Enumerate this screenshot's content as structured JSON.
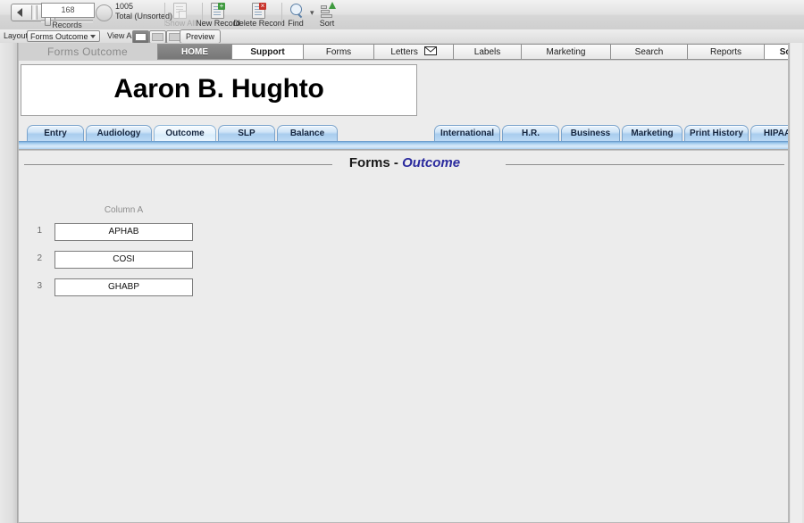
{
  "toolbar": {
    "record_number": "168",
    "records_label": "Records",
    "total_count": "1005",
    "total_label": "Total (Unsorted)",
    "buttons": [
      {
        "name": "show-all",
        "label": "Show All",
        "icon": "show-all-icon",
        "disabled": true
      },
      {
        "name": "new-record",
        "label": "New Record",
        "icon": "new-record-icon",
        "disabled": false
      },
      {
        "name": "delete-record",
        "label": "Delete Record",
        "icon": "delete-record-icon",
        "disabled": false
      },
      {
        "name": "find",
        "label": "Find",
        "icon": "magnifier-icon",
        "disabled": false
      },
      {
        "name": "sort",
        "label": "Sort",
        "icon": "sort-icon",
        "disabled": false
      }
    ]
  },
  "layoutbar": {
    "layout_label": "Layout:",
    "layout_value": "Forms Outcome",
    "viewas_label": "View As:",
    "preview_label": "Preview"
  },
  "header": {
    "layout_title": "Forms Outcome",
    "top_tabs": [
      {
        "label": "HOME",
        "style": "dark"
      },
      {
        "label": "Support",
        "style": "white"
      },
      {
        "label": "Forms",
        "style": "plain"
      },
      {
        "label": "Letters",
        "style": "plain",
        "icon": "envelope-icon"
      },
      {
        "label": "Labels",
        "style": "plain"
      },
      {
        "label": "Marketing",
        "style": "plain"
      },
      {
        "label": "Search",
        "style": "plain"
      },
      {
        "label": "Reports",
        "style": "plain"
      },
      {
        "label": "Schedule",
        "style": "white"
      }
    ]
  },
  "patient": {
    "name": "Aaron B. Hughto"
  },
  "tabs_left": [
    {
      "label": "Entry",
      "active": false
    },
    {
      "label": "Audiology",
      "active": false
    },
    {
      "label": "Outcome",
      "active": true
    },
    {
      "label": "SLP",
      "active": false
    },
    {
      "label": "Balance",
      "active": false
    }
  ],
  "tabs_right": [
    {
      "label": "International",
      "active": false
    },
    {
      "label": "H.R.",
      "active": false
    },
    {
      "label": "Business",
      "active": false
    },
    {
      "label": "Marketing",
      "active": false
    },
    {
      "label": "Print History",
      "active": false
    },
    {
      "label": "HIPAA",
      "active": false
    }
  ],
  "page_title": {
    "prefix": "Forms - ",
    "accent": "Outcome"
  },
  "list": {
    "column_header": "Column A",
    "rows": [
      {
        "index": "1",
        "value": "APHAB"
      },
      {
        "index": "2",
        "value": "COSI"
      },
      {
        "index": "3",
        "value": "GHABP"
      }
    ]
  },
  "colors": {
    "accent_blue": "#2b2b9e",
    "tab_blue": "#a9cdee",
    "canvas": "#ececec"
  }
}
